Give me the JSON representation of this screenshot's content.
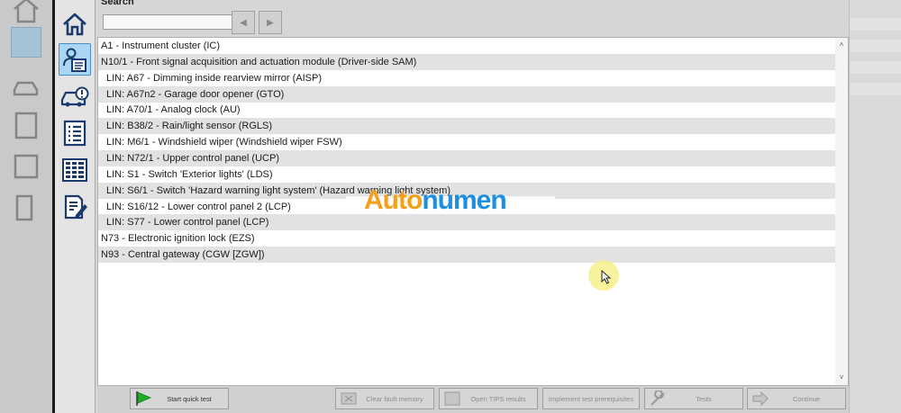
{
  "search": {
    "label": "Search",
    "value": "",
    "prev_icon": "◀",
    "next_icon": "▶"
  },
  "sidebar_icons": [
    "home-icon",
    "control-unit-list-icon",
    "vehicle-warning-icon",
    "checklist-icon",
    "grid-list-icon",
    "document-edit-icon"
  ],
  "list": {
    "rows": [
      {
        "text": "A1 - Instrument cluster (IC)",
        "level": 0
      },
      {
        "text": "N10/1 - Front signal acquisition and actuation module (Driver-side SAM)",
        "level": 0
      },
      {
        "text": "LIN: A67 - Dimming inside rearview mirror (AISP)",
        "level": 1
      },
      {
        "text": "LIN: A67n2 - Garage door opener (GTO)",
        "level": 1
      },
      {
        "text": "LIN: A70/1 - Analog clock (AU)",
        "level": 1
      },
      {
        "text": "LIN: B38/2 - Rain/light sensor (RGLS)",
        "level": 1
      },
      {
        "text": "LIN: M6/1 - Windshield wiper (Windshield wiper FSW)",
        "level": 1
      },
      {
        "text": "LIN: N72/1 - Upper control panel (UCP)",
        "level": 1
      },
      {
        "text": "LIN: S1 - Switch 'Exterior lights' (LDS)",
        "level": 1
      },
      {
        "text": "LIN: S6/1 - Switch 'Hazard warning light system' (Hazard warning light system)",
        "level": 1
      },
      {
        "text": "LIN: S16/12 - Lower control panel 2 (LCP)",
        "level": 1
      },
      {
        "text": "LIN: S77 - Lower control panel (LCP)",
        "level": 1
      },
      {
        "text": "N73 - Electronic ignition lock (EZS)",
        "level": 0
      },
      {
        "text": "N93 - Central gateway (CGW [ZGW])",
        "level": 0
      }
    ],
    "scroll_up": "˄",
    "scroll_down": "˅"
  },
  "bottom_buttons": [
    {
      "label": "Start quick test",
      "enabled": true,
      "icon": "flag-icon"
    },
    {
      "label": "Clear fault memory",
      "enabled": false,
      "icon": "clear-memory-icon"
    },
    {
      "label": "Open TIPS results",
      "enabled": false,
      "icon": "tips-icon"
    },
    {
      "label": "Implement test prerequisites",
      "enabled": false,
      "icon": ""
    },
    {
      "label": "Tests",
      "enabled": false,
      "icon": "wrench-icon"
    },
    {
      "label": "Continue",
      "enabled": false,
      "icon": "arrow-right-icon"
    }
  ],
  "watermark": {
    "part1": "Auto",
    "part2": "numen"
  },
  "colors": {
    "accent_selected": "#a9d6f5",
    "row_alt": "#e2e2e2",
    "start_flag": "#1fae2a",
    "watermark_orange": "#f6a01a",
    "watermark_blue": "#1d8fe0"
  }
}
